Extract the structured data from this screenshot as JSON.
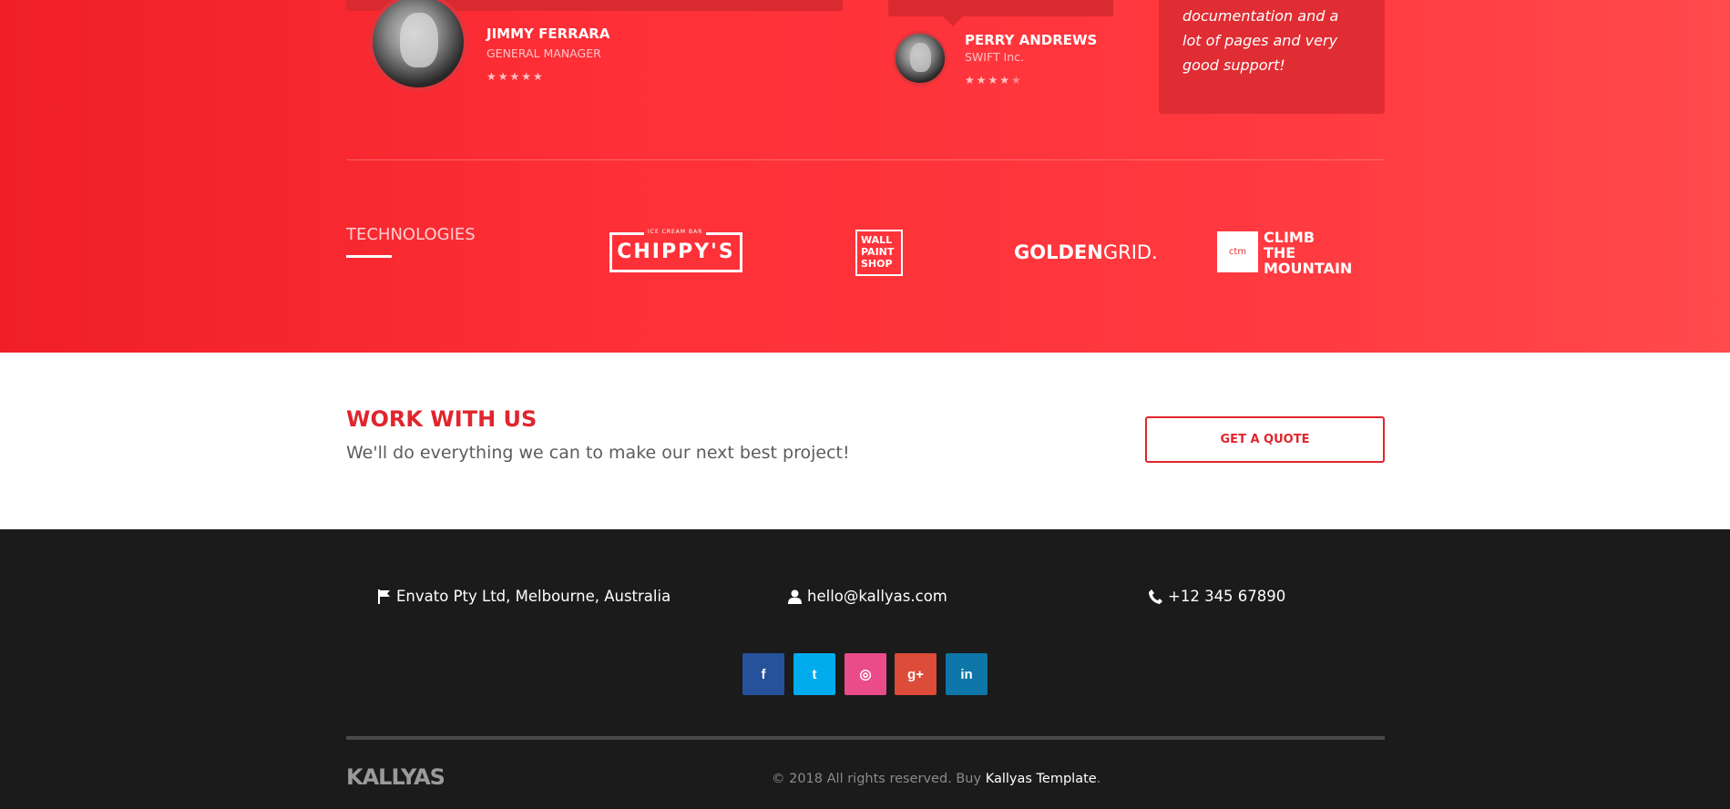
{
  "testimonials": [
    {
      "name": "JIMMY FERRARA",
      "role": "GENERAL MANAGER",
      "stars": 5,
      "rating_text": "★★★★★"
    },
    {
      "name": "PERRY ANDREWS",
      "role": "SWIFT Inc.",
      "stars": 4,
      "rating_on": "★★★★",
      "rating_off": "★"
    }
  ],
  "quote_box": {
    "text": "documentation and a lot of pages and very good support!"
  },
  "technologies": {
    "title": "TECHNOLOGIES",
    "logos": {
      "chippys_small": "ICE CREAM BAR",
      "chippys_big": "CHIPPY'S",
      "wall_line1": "WALL",
      "wall_line2": "PAINT",
      "wall_line3": "SHOP",
      "golden_bold": "GOLDEN",
      "golden_light": "GRID.",
      "ctm_box": "ctm",
      "ctm_line1": "CLIMB",
      "ctm_line2": "THE",
      "ctm_line3": "MOUNTAIN"
    }
  },
  "cta": {
    "title": "WORK WITH US",
    "subtitle": "We'll do everything we can to make our next best project!",
    "button": "GET A QUOTE"
  },
  "footer": {
    "address": "Envato Pty Ltd, Melbourne, Australia",
    "email": "hello@kallyas.com",
    "phone": "+12 345 67890",
    "social": [
      {
        "name": "facebook",
        "glyph": "f",
        "color": "#25529a"
      },
      {
        "name": "twitter",
        "glyph": "t",
        "color": "#00acee"
      },
      {
        "name": "dribbble",
        "glyph": "◎",
        "color": "#ea4c89"
      },
      {
        "name": "google-plus",
        "glyph": "g+",
        "color": "#dd4b39"
      },
      {
        "name": "linkedin",
        "glyph": "in",
        "color": "#0e76a8"
      }
    ],
    "brand": "KALLYAS",
    "copyright_prefix": "© 2018 All rights reserved. Buy ",
    "copyright_link": "Kallyas Template",
    "copyright_suffix": "."
  }
}
